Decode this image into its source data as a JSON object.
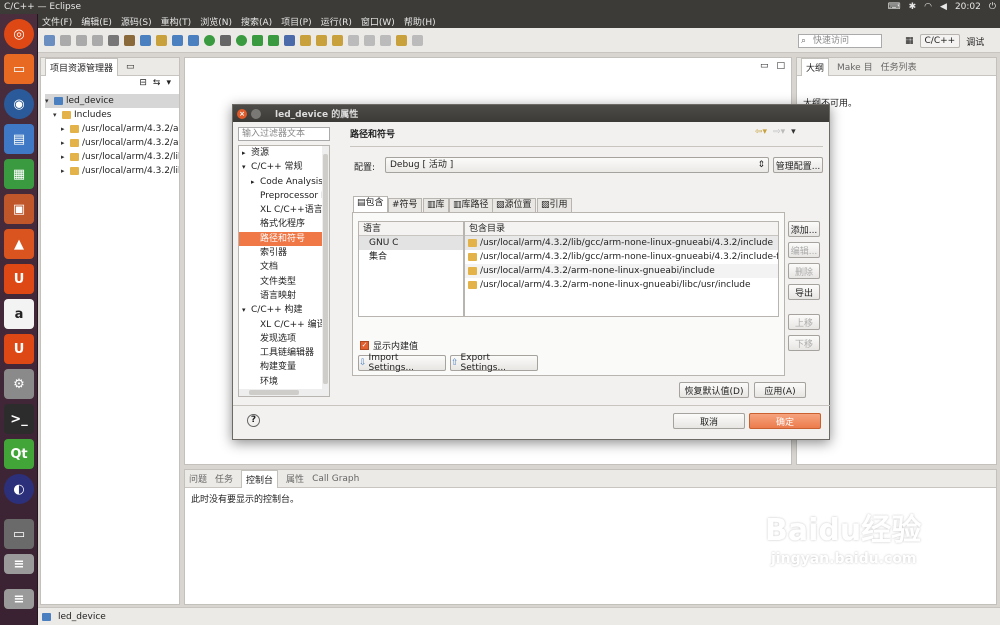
{
  "window_title": "C/C++ — Eclipse",
  "clock": "20:02",
  "menu": [
    "文件(F)",
    "编辑(E)",
    "源码(S)",
    "重构(T)",
    "浏览(N)",
    "搜索(A)",
    "项目(P)",
    "运行(R)",
    "窗口(W)",
    "帮助(H)"
  ],
  "quick_access_placeholder": "快速访问",
  "perspectives": {
    "cpp": "C/C++",
    "debug": "调试"
  },
  "explorer": {
    "tab": "项目资源管理器",
    "project": "led_device",
    "includes": "Includes",
    "items": [
      "/usr/local/arm/4.3.2/arm",
      "/usr/local/arm/4.3.2/arm",
      "/usr/local/arm/4.3.2/lib/",
      "/usr/local/arm/4.3.2/lib/"
    ]
  },
  "outline": {
    "tabs": [
      "大纲",
      "Make 目",
      "任务列表"
    ],
    "message": "大纲不可用。"
  },
  "console": {
    "tabs": [
      "问题",
      "任务",
      "控制台",
      "属性",
      "Call Graph"
    ],
    "message": "此时没有要显示的控制台。"
  },
  "status_project": "led_device",
  "dialog": {
    "title": "led_device 的属性",
    "filter_placeholder": "输入过滤器文本",
    "nav": [
      {
        "label": "资源",
        "level": 0,
        "tri": "▸"
      },
      {
        "label": "C/C++ 常规",
        "level": 0,
        "tri": "▾"
      },
      {
        "label": "Code Analysis",
        "level": 1,
        "tri": "▸"
      },
      {
        "label": "Preprocessor Inclu",
        "level": 1,
        "tri": ""
      },
      {
        "label": "XL C/C++语言选项",
        "level": 1,
        "tri": ""
      },
      {
        "label": "格式化程序",
        "level": 1,
        "tri": ""
      },
      {
        "label": "路径和符号",
        "level": 1,
        "tri": "",
        "selected": true
      },
      {
        "label": "索引器",
        "level": 1,
        "tri": ""
      },
      {
        "label": "文档",
        "level": 1,
        "tri": ""
      },
      {
        "label": "文件类型",
        "level": 1,
        "tri": ""
      },
      {
        "label": "语言映射",
        "level": 1,
        "tri": ""
      },
      {
        "label": "C/C++ 构建",
        "level": 0,
        "tri": "▾"
      },
      {
        "label": "XL C/C++ 编译器",
        "level": 1,
        "tri": ""
      },
      {
        "label": "发现选项",
        "level": 1,
        "tri": ""
      },
      {
        "label": "工具链编辑器",
        "level": 1,
        "tri": ""
      },
      {
        "label": "构建变量",
        "level": 1,
        "tri": ""
      },
      {
        "label": "环境",
        "level": 1,
        "tri": ""
      }
    ],
    "heading": "路径和符号",
    "config_label": "配置:",
    "config_value": "Debug [ 活动 ]",
    "manage_button": "管理配置...",
    "tabs": [
      "包含",
      "符号",
      "库",
      "库路径",
      "源位置",
      "引用"
    ],
    "lang_header": "语言",
    "languages": [
      "GNU C",
      "集合"
    ],
    "dir_header": "包含目录",
    "dirs": [
      "/usr/local/arm/4.3.2/lib/gcc/arm-none-linux-gnueabi/4.3.2/include",
      "/usr/local/arm/4.3.2/lib/gcc/arm-none-linux-gnueabi/4.3.2/include-fixed",
      "/usr/local/arm/4.3.2/arm-none-linux-gnueabi/include",
      "/usr/local/arm/4.3.2/arm-none-linux-gnueabi/libc/usr/include"
    ],
    "side_buttons": [
      "添加...",
      "编辑...",
      "删除",
      "导出",
      "上移",
      "下移"
    ],
    "show_builtin": "显示内建值",
    "import_button": "Import Settings...",
    "export_button": "Export Settings...",
    "restore_button": "恢复默认值(D)",
    "apply_button": "应用(A)",
    "cancel_button": "取消",
    "ok_button": "确定",
    "help": "?"
  },
  "watermark": {
    "brand": "Baidu经验",
    "url": "jingyan.baidu.com"
  },
  "colors": {
    "ok_button": "#f08a5d",
    "selection": "#f07746",
    "launcher": "#4a2e3e"
  }
}
